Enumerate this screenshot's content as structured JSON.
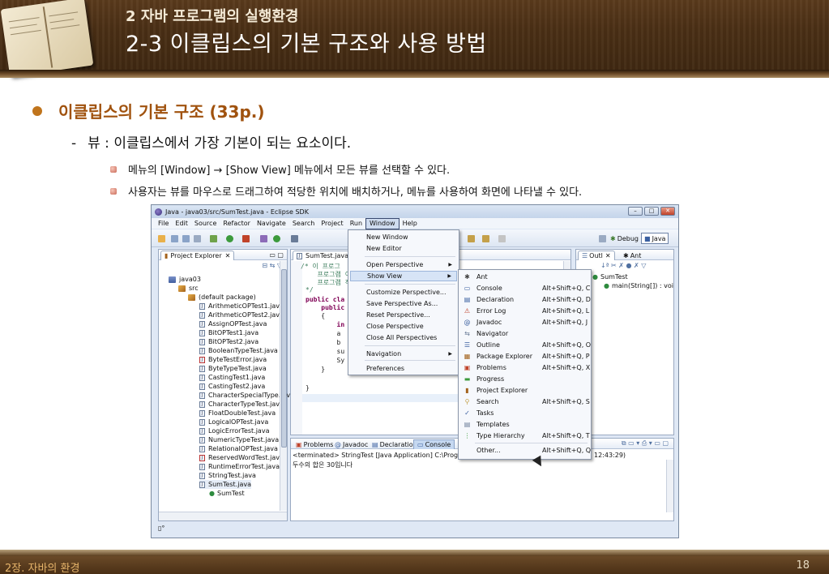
{
  "slide": {
    "subtitle": "2 자바 프로그램의 실행환경",
    "title": "2-3 이클립스의 기본 구조와 사용 방법",
    "bullet_main": "이클립스의 기본 구조 (33p.)",
    "bullet_dash": "-",
    "bullet_sub": "뷰 : 이클립스에서 가장 기본이 되는 요소이다.",
    "points": [
      "메뉴의 [Window] → [Show View] 메뉴에서 모든 뷰를 선택할 수 있다.",
      "사용자는 뷰를 마우스로 드래그하여 적당한 위치에 배치하거나, 메뉴를 사용하여 화면에 나타낼 수 있다."
    ],
    "footer_left": "2장. 자바의 환경",
    "page_number": "18",
    "colors": {
      "header_brown": "#4a2f15",
      "heading_orange": "#a0520e",
      "bullet_dot": "#c0741c"
    }
  },
  "eclipse": {
    "window_title": "Java - java03/src/SumTest.java - Eclipse SDK",
    "menubar": [
      "File",
      "Edit",
      "Source",
      "Refactor",
      "Navigate",
      "Search",
      "Project",
      "Run",
      "Window",
      "Help"
    ],
    "perspectives": {
      "debug": "Debug",
      "java": "Java"
    },
    "explorer": {
      "tab": "Project Explorer",
      "project": "java03",
      "src": "src",
      "package": "(default package)",
      "files": [
        "ArithmeticOPTest1.java",
        "ArithmeticOPTest2.java",
        "AssignOPTest.java",
        "BitOPTest1.java",
        "BitOPTest2.java",
        "BooleanTypeTest.java",
        "ByteTestError.java",
        "ByteTypeTest.java",
        "CastingTest1.java",
        "CastingTest2.java",
        "CharacterSpecialType.jav",
        "CharacterTypeTest.java",
        "FloatDoubleTest.java",
        "LogicalOPTest.java",
        "LogicErrorTest.java",
        "NumericTypeTest.java",
        "RelationalOPTest.java",
        "ReservedWordTest.java",
        "RuntimeErrorTest.java",
        "StringTest.java",
        "SumTest.java"
      ],
      "class_node": "SumTest"
    },
    "editor": {
      "tab": "SumTest.java",
      "lines": [
        "/* 이 프로그",
        "   프로그램 이",
        "   프로그램 작",
        "*/",
        "public cla",
        "    public",
        "    {",
        "        in",
        "        a",
        "        b",
        "        su",
        "        Sy",
        "    }",
        "}"
      ]
    },
    "outline": {
      "tab1": "Outl",
      "tab2": "Ant",
      "class": "SumTest",
      "method": "main(String[]) : voi"
    },
    "console": {
      "tabs": [
        "Problems",
        "Javadoc",
        "Declaration",
        "Console"
      ],
      "terminated": "<terminated> StringTest [Java Application] C:\\Program File",
      "time": "12:43:29)",
      "output": "두수의 합은 30입니다"
    },
    "window_menu": {
      "items": [
        "New Window",
        "New Editor",
        "Open Perspective",
        "Show View",
        "Customize Perspective...",
        "Save Perspective As...",
        "Reset Perspective...",
        "Close Perspective",
        "Close All Perspectives",
        "Navigation",
        "Preferences"
      ]
    },
    "show_view_menu": {
      "items": [
        {
          "label": "Ant",
          "key": "",
          "icon": "ant-icon"
        },
        {
          "label": "Console",
          "key": "Alt+Shift+Q, C",
          "icon": "console-icon"
        },
        {
          "label": "Declaration",
          "key": "Alt+Shift+Q, D",
          "icon": "declaration-icon"
        },
        {
          "label": "Error Log",
          "key": "Alt+Shift+Q, L",
          "icon": "error-log-icon"
        },
        {
          "label": "Javadoc",
          "key": "Alt+Shift+Q, J",
          "icon": "javadoc-icon"
        },
        {
          "label": "Navigator",
          "key": "",
          "icon": "navigator-icon"
        },
        {
          "label": "Outline",
          "key": "Alt+Shift+Q, O",
          "icon": "outline-icon"
        },
        {
          "label": "Package Explorer",
          "key": "Alt+Shift+Q, P",
          "icon": "package-explorer-icon"
        },
        {
          "label": "Problems",
          "key": "Alt+Shift+Q, X",
          "icon": "problems-icon"
        },
        {
          "label": "Progress",
          "key": "",
          "icon": "progress-icon"
        },
        {
          "label": "Project Explorer",
          "key": "",
          "icon": "project-explorer-icon"
        },
        {
          "label": "Search",
          "key": "Alt+Shift+Q, S",
          "icon": "search-icon"
        },
        {
          "label": "Tasks",
          "key": "",
          "icon": "tasks-icon"
        },
        {
          "label": "Templates",
          "key": "",
          "icon": "templates-icon"
        },
        {
          "label": "Type Hierarchy",
          "key": "Alt+Shift+Q, T",
          "icon": "type-hierarchy-icon"
        },
        {
          "label": "Other...",
          "key": "Alt+Shift+Q, Q",
          "icon": ""
        }
      ]
    }
  }
}
